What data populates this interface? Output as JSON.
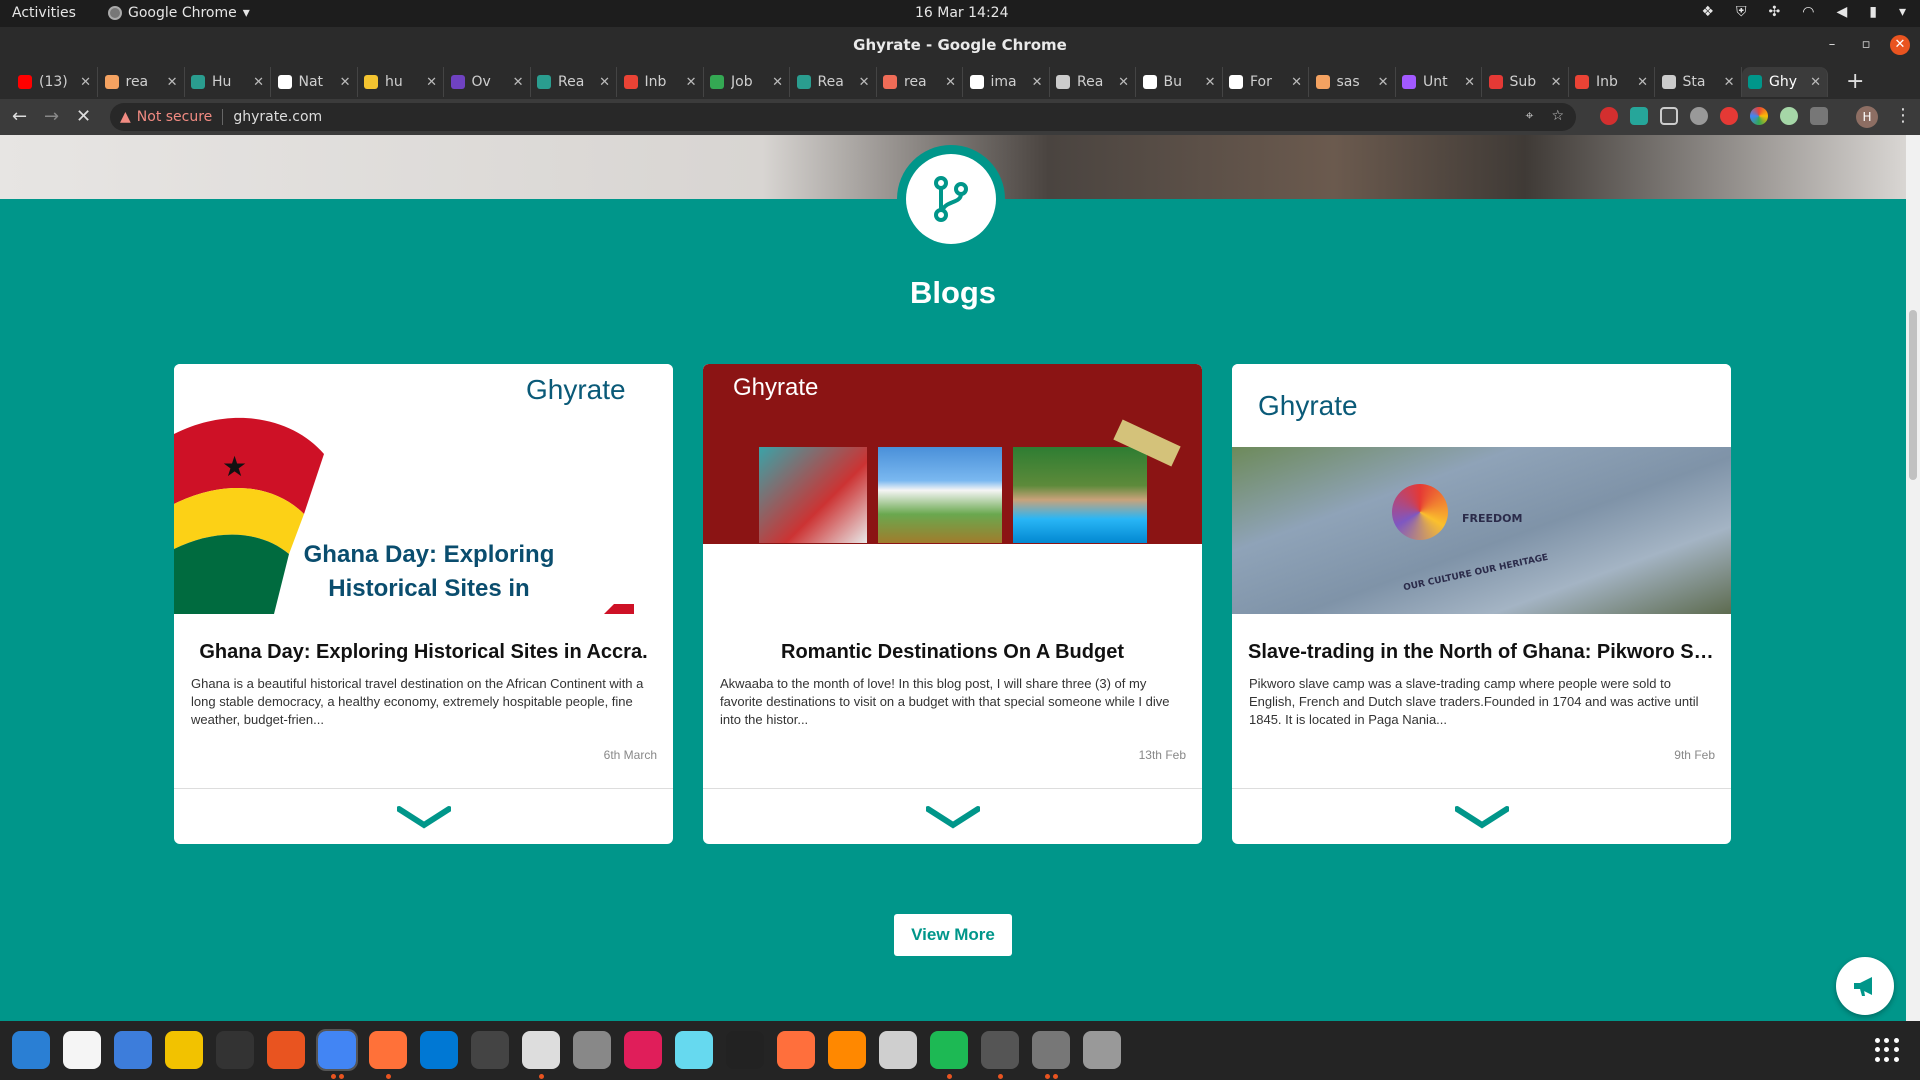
{
  "system_bar": {
    "activities": "Activities",
    "app_menu": "Google Chrome",
    "clock": "16 Mar  14:24"
  },
  "window": {
    "title": "Ghyrate - Google Chrome"
  },
  "tabs": [
    {
      "label": "(13)",
      "color": "#ff0000"
    },
    {
      "label": "rea",
      "color": "#f4a261"
    },
    {
      "label": "Hu",
      "color": "#2a9d8f"
    },
    {
      "label": "Nat",
      "color": "#ffffff"
    },
    {
      "label": "hu",
      "color": "#f4c430"
    },
    {
      "label": "Ov",
      "color": "#6f42c1"
    },
    {
      "label": "Rea",
      "color": "#2a9d8f"
    },
    {
      "label": "Inb",
      "color": "#ea4335"
    },
    {
      "label": "Job",
      "color": "#34a853"
    },
    {
      "label": "Rea",
      "color": "#2a9d8f"
    },
    {
      "label": "rea",
      "color": "#ef6c57"
    },
    {
      "label": "ima",
      "color": "#ffffff"
    },
    {
      "label": "Rea",
      "color": "#cccccc"
    },
    {
      "label": "Bu",
      "color": "#ffffff"
    },
    {
      "label": "For",
      "color": "#ffffff"
    },
    {
      "label": "sas",
      "color": "#f4a261"
    },
    {
      "label": "Unt",
      "color": "#a259ff"
    },
    {
      "label": "Sub",
      "color": "#e53935"
    },
    {
      "label": "Inb",
      "color": "#ea4335"
    },
    {
      "label": "Sta",
      "color": "#cccccc"
    },
    {
      "label": "Ghy",
      "color": "#00968a",
      "active": true
    }
  ],
  "address_bar": {
    "security": "Not secure",
    "url": "ghyrate.com"
  },
  "page": {
    "section_title": "Blogs",
    "brand_name": "Ghyrate",
    "view_more": "View More",
    "accent_color": "#00968a",
    "cards": [
      {
        "title": "Ghana Day: Exploring Historical Sites in Accra.",
        "excerpt": "Ghana is a beautiful historical travel destination on the African Continent with a long stable democracy, a healthy economy, extremely hospitable people, fine weather, budget-frien...",
        "date": "6th March",
        "image_text": "Ghana Day: Exploring Historical Sites in"
      },
      {
        "title": "Romantic Destinations On A Budget",
        "excerpt": "Akwaaba to the month of love! In this blog post, I will share three (3) of my favorite destinations to visit on a budget with that special someone while I dive into the histor...",
        "date": "13th Feb"
      },
      {
        "title": "Slave-trading in the North of Ghana: Pikworo Sla...",
        "excerpt": "Pikworo slave camp was a slave-trading camp where people were sold to English, French and Dutch slave traders.Founded in 1704 and was active until 1845. It is located in Paga Nania...",
        "date": "9th Feb",
        "image_text": "FREEDOM",
        "image_text_2": "OUR CULTURE OUR HERITAGE"
      }
    ]
  },
  "dock_apps": [
    "libreoffice-writer",
    "text-editor",
    "thunderbird",
    "rhythmbox",
    "terminal",
    "software-center",
    "chrome",
    "firefox",
    "vscode",
    "system-monitor",
    "files",
    "settings-dial",
    "slack",
    "atom",
    "downloader",
    "vector-editor",
    "vlc",
    "archive",
    "spotify",
    "calculator",
    "system-settings",
    "disk-tool"
  ]
}
